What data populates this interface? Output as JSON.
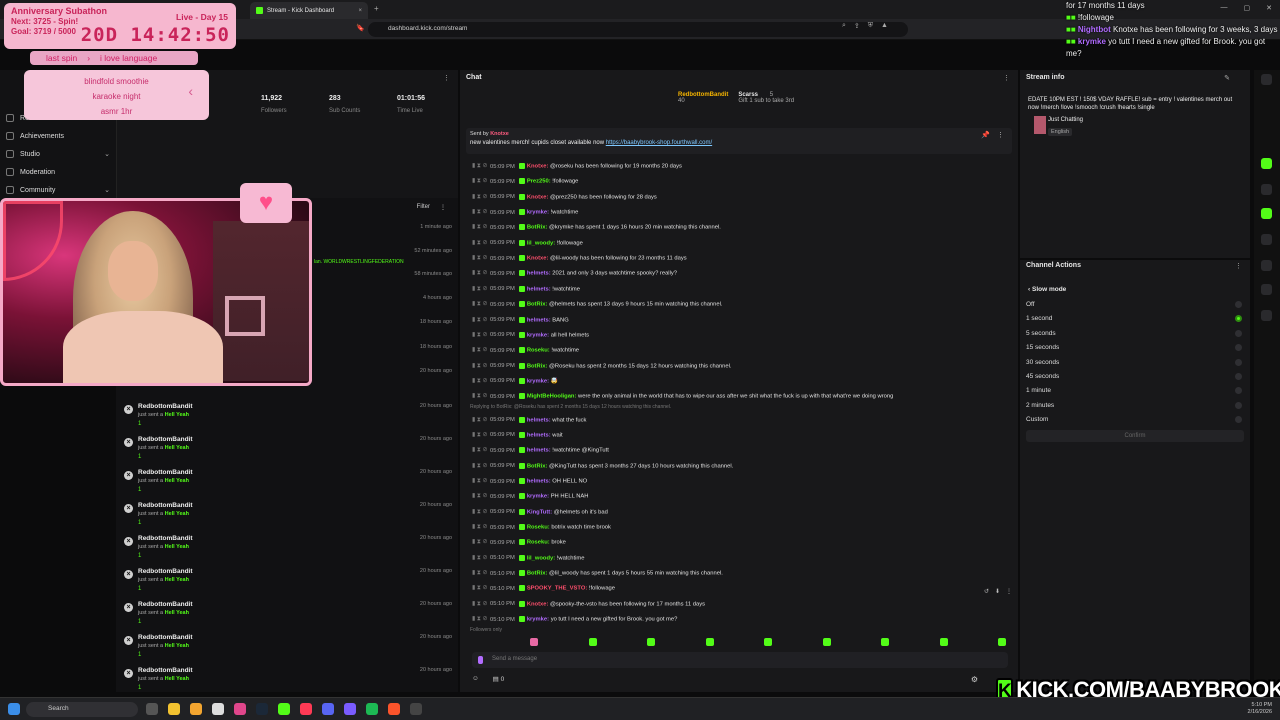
{
  "browser": {
    "tab_title": "Stream - Kick Dashboard",
    "url": "dashboard.kick.com/stream"
  },
  "overlay": {
    "goal_title": "Anniversary Subathon",
    "next": "Next: 3725 - Spin!",
    "goal": "Goal: 3719 / 5000",
    "live": "Live - Day 15",
    "timer": "20D 14:42:50",
    "last_spin_label": "last spin",
    "last_spin_value": "i love language",
    "spin_items": [
      "blindfold smoothie",
      "karaoke night",
      "asmr 1hr"
    ]
  },
  "sidebar": {
    "items": [
      {
        "label": "Revenue"
      },
      {
        "label": "Achievements"
      },
      {
        "label": "Studio"
      },
      {
        "label": "Moderation"
      },
      {
        "label": "Community"
      }
    ]
  },
  "stats": {
    "followers_value": "11,922",
    "followers_label": "Followers",
    "subs_value": "283",
    "subs_label": "Sub Counts",
    "time_value": "01:01:56",
    "time_label": "Time Live"
  },
  "feed": {
    "filter_label": "Filter",
    "highlight": "lan. WORLDWRESTLINGFEDERATION",
    "old_times": [
      "1 minute ago",
      "52 minutes ago",
      "58 minutes ago",
      "4 hours ago",
      "18 hours ago",
      "18 hours ago",
      "20 hours ago"
    ],
    "events": [
      {
        "name": "RedbottomBandit",
        "sub": "just sent a",
        "gift": "Hell Yeah",
        "count": "1",
        "time": "20 hours ago"
      },
      {
        "name": "RedbottomBandit",
        "sub": "just sent a",
        "gift": "Hell Yeah",
        "count": "1",
        "time": "20 hours ago"
      },
      {
        "name": "RedbottomBandit",
        "sub": "just sent a",
        "gift": "Hell Yeah",
        "count": "1",
        "time": "20 hours ago"
      },
      {
        "name": "RedbottomBandit",
        "sub": "just sent a",
        "gift": "Hell Yeah",
        "count": "1",
        "time": "20 hours ago"
      },
      {
        "name": "RedbottomBandit",
        "sub": "just sent a",
        "gift": "Hell Yeah",
        "count": "1",
        "time": "20 hours ago"
      },
      {
        "name": "RedbottomBandit",
        "sub": "just sent a",
        "gift": "Hell Yeah",
        "count": "1",
        "time": "20 hours ago"
      },
      {
        "name": "RedbottomBandit",
        "sub": "just sent a",
        "gift": "Hell Yeah",
        "count": "1",
        "time": "20 hours ago"
      },
      {
        "name": "RedbottomBandit",
        "sub": "just sent a",
        "gift": "Hell Yeah",
        "count": "1",
        "time": "20 hours ago"
      },
      {
        "name": "RedbottomBandit",
        "sub": "just sent a",
        "gift": "Hell Yeah",
        "count": "1",
        "time": "20 hours ago"
      }
    ]
  },
  "chat": {
    "title": "Chat",
    "top_gifter_1": "RedbottomBandit",
    "top_gifter_1_count": "40",
    "top_gifter_2": "Scarss",
    "top_gifter_2_count": "5",
    "gift_note": "Gift 1 sub to take 3rd",
    "pinned_by_label": "Sent by",
    "pinned_by_user": "Knotxe",
    "pinned_message": "new valentines merch! cupids closet available now",
    "pinned_link": "https://baabybrook-shop.fourthwall.com/",
    "reply_note": "Replying to BotRix: @Roseku has spent 2 months 15 days 12 hours watching this channel.",
    "followers_only": "Followers only",
    "send_placeholder": "Send a message",
    "footer_count": "0",
    "messages": [
      {
        "time": "05:09 PM",
        "user": "Knotxe:",
        "color": "#ff4f6d",
        "text": "@roseku has been following for 19 months 20 days"
      },
      {
        "time": "05:09 PM",
        "user": "Prez250:",
        "color": "#53fc18",
        "text": "!followage"
      },
      {
        "time": "05:09 PM",
        "user": "Knotxe:",
        "color": "#ff4f6d",
        "text": "@prez250 has been following for 28 days"
      },
      {
        "time": "05:09 PM",
        "user": "krymke:",
        "color": "#b26cff",
        "text": "!watchtime"
      },
      {
        "time": "05:09 PM",
        "user": "BotRix:",
        "color": "#53fc18",
        "text": "@krymke has spent 1 days 16 hours 20 min watching this channel."
      },
      {
        "time": "05:09 PM",
        "user": "lil_woody:",
        "color": "#53fc18",
        "text": "!followage"
      },
      {
        "time": "05:09 PM",
        "user": "Knotxe:",
        "color": "#ff4f6d",
        "text": "@lil-woody has been following for 23 months 11 days"
      },
      {
        "time": "05:09 PM",
        "user": "helmets:",
        "color": "#b26cff",
        "text": "2021 and only 3 days watchtime spooky? really?"
      },
      {
        "time": "05:09 PM",
        "user": "helmets:",
        "color": "#b26cff",
        "text": "!watchtime"
      },
      {
        "time": "05:09 PM",
        "user": "BotRix:",
        "color": "#53fc18",
        "text": "@helmets has spent 13 days 9 hours 15 min watching this channel."
      },
      {
        "time": "05:09 PM",
        "user": "helmets:",
        "color": "#b26cff",
        "text": "BANG"
      },
      {
        "time": "05:09 PM",
        "user": "krymke:",
        "color": "#b26cff",
        "text": "all hell helmets"
      },
      {
        "time": "05:09 PM",
        "user": "Roseku:",
        "color": "#53fc18",
        "text": "!watchtime"
      },
      {
        "time": "05:09 PM",
        "user": "BotRix:",
        "color": "#53fc18",
        "text": "@Roseku has spent 2 months 15 days 12 hours watching this channel."
      },
      {
        "time": "05:09 PM",
        "user": "krymke:",
        "color": "#b26cff",
        "text": "🤯"
      },
      {
        "time": "05:09 PM",
        "user": "MightBeHooligan:",
        "color": "#53fc18",
        "text": "were the only animal in the world that has to wipe our ass after we shit what the fuck is up with that what're we doing wrong"
      },
      {
        "time": "05:09 PM",
        "user": "helmets:",
        "color": "#b26cff",
        "text": "what the fuck"
      },
      {
        "time": "05:09 PM",
        "user": "helmets:",
        "color": "#b26cff",
        "text": "wait"
      },
      {
        "time": "05:09 PM",
        "user": "helmets:",
        "color": "#b26cff",
        "text": "!watchtime @KingTutt"
      },
      {
        "time": "05:09 PM",
        "user": "BotRix:",
        "color": "#53fc18",
        "text": "@KingTutt has spent 3 months 27 days 10 hours watching this channel."
      },
      {
        "time": "05:09 PM",
        "user": "helmets:",
        "color": "#b26cff",
        "text": "OH HELL NO"
      },
      {
        "time": "05:09 PM",
        "user": "krymke:",
        "color": "#b26cff",
        "text": "PH HELL NAH"
      },
      {
        "time": "05:09 PM",
        "user": "KingTutt:",
        "color": "#b26cff",
        "text": "@helmets oh it's bad"
      },
      {
        "time": "05:09 PM",
        "user": "Roseku:",
        "color": "#53fc18",
        "text": "botrix watch time brook"
      },
      {
        "time": "05:09 PM",
        "user": "Roseku:",
        "color": "#53fc18",
        "text": "broke"
      },
      {
        "time": "05:10 PM",
        "user": "lil_woody:",
        "color": "#53fc18",
        "text": "!watchtime"
      },
      {
        "time": "05:10 PM",
        "user": "BotRix:",
        "color": "#53fc18",
        "text": "@lil_woody has spent 1 days 5 hours 55 min watching this channel."
      },
      {
        "time": "05:10 PM",
        "user": "SPOOKY_THE_VSTO:",
        "color": "#ff4f6d",
        "text": "!followage"
      },
      {
        "time": "05:10 PM",
        "user": "Knotxe:",
        "color": "#ff4f6d",
        "text": "@spooky-the-vsto has been following for 17 months 11 days"
      },
      {
        "time": "05:10 PM",
        "user": "krymke:",
        "color": "#b26cff",
        "text": "yo tutt I need a new gifted for Brook. you got me?"
      }
    ]
  },
  "stream_info": {
    "title": "Stream info",
    "text": "EDATE 10PM EST ! 150$ VDAY RAFFLE! sub = entry ! valentines merch out now !merch !love !smooch !crush !hearts !single",
    "category": "Just Chatting",
    "language": "English"
  },
  "channel_actions": {
    "title": "Channel Actions",
    "submenu": "Slow mode",
    "options": [
      "Off",
      "1 second",
      "5 seconds",
      "15 seconds",
      "30 seconds",
      "45 seconds",
      "1 minute",
      "2 minutes",
      "Custom"
    ],
    "selected": 1,
    "confirm_label": "Confirm"
  },
  "notifications": {
    "line1": "for 17 months 11 days",
    "line2_user": "",
    "line2_text": "!followage",
    "line3_user": "Nightbot",
    "line3_text": "Knotxe has been following for 3 weeks, 3 days",
    "line4_user": "krymke",
    "line4_text": "yo tutt I need a new gifted for Brook. you got me?"
  },
  "taskbar": {
    "search_label": "Search",
    "clock_time": "5:10 PM",
    "clock_date": "2/16/2026"
  },
  "banner": {
    "text": "KICK.COM/BAABYBROOK"
  },
  "colors": {
    "kick_green": "#53fc18",
    "overlay_pink": "#f6b7cf",
    "overlay_text": "#c9245a"
  }
}
